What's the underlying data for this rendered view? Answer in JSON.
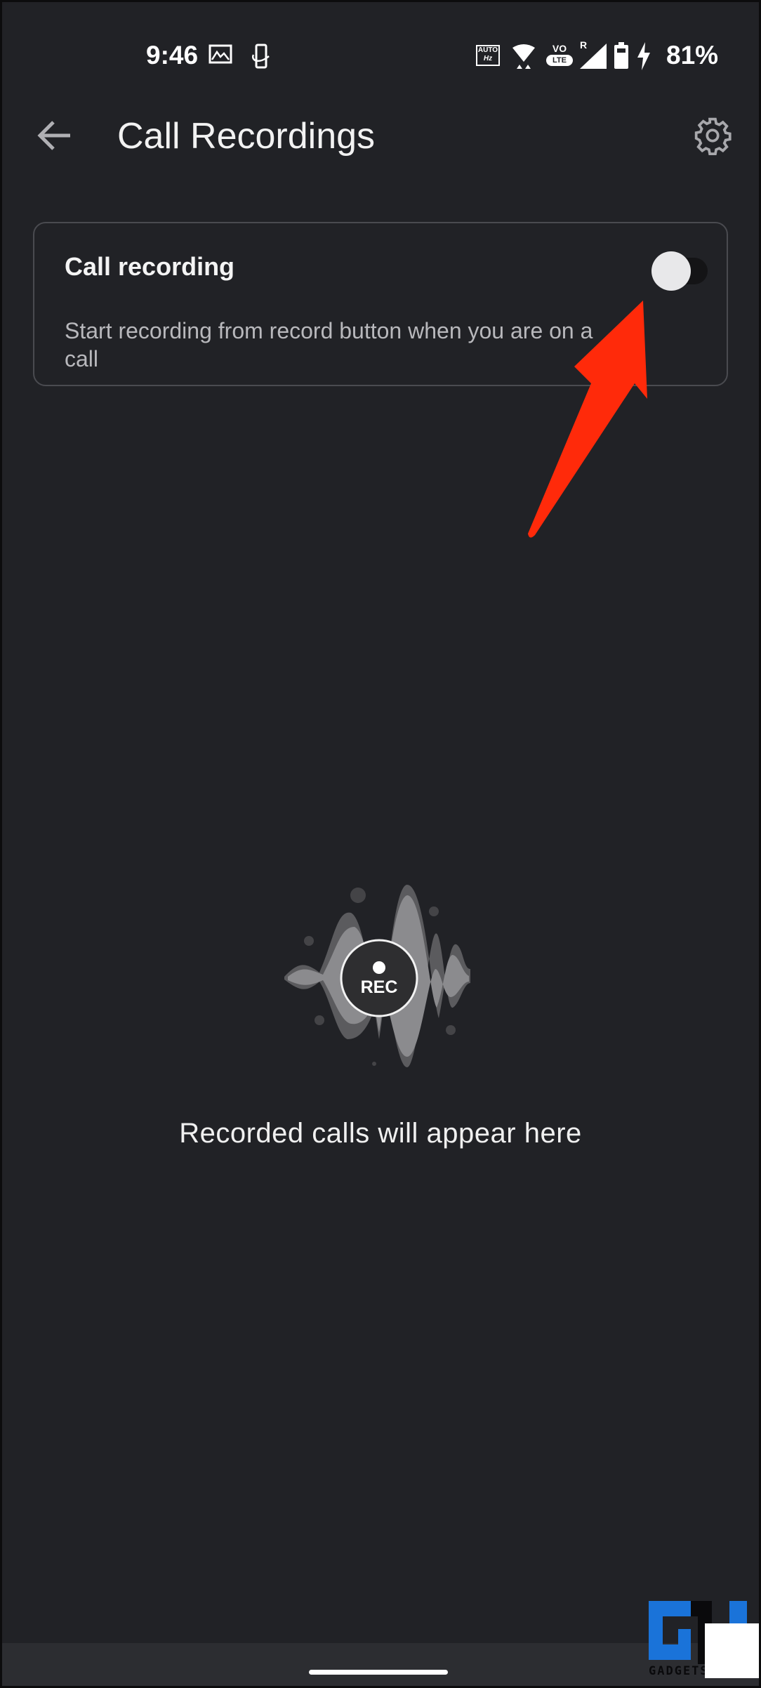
{
  "status_bar": {
    "time": "9:46",
    "battery_percent": "81%",
    "left_icons": [
      "gallery-icon",
      "screen-rotate-icon"
    ],
    "right_icons": [
      "auto-hz-icon",
      "wifi-icon",
      "volte-icon",
      "signal-icon",
      "battery-icon",
      "charging-icon"
    ],
    "auto_label": "AUTO",
    "hz_label": "Hz",
    "vo_label": "VO",
    "lte_label": "LTE",
    "roaming_label": "R"
  },
  "header": {
    "title": "Call Recordings",
    "back_icon": "arrow-left-icon",
    "settings_icon": "gear-icon"
  },
  "setting_card": {
    "title": "Call recording",
    "description": "Start recording from record button when you are on a call",
    "toggle_on": false
  },
  "empty_state": {
    "badge_label": "REC",
    "message": "Recorded calls will appear here"
  },
  "colors": {
    "background": "#212226",
    "annotation_arrow": "#ff2a0a",
    "watermark_blue": "#1a73d9"
  },
  "watermark": {
    "text": "GADGETS"
  }
}
